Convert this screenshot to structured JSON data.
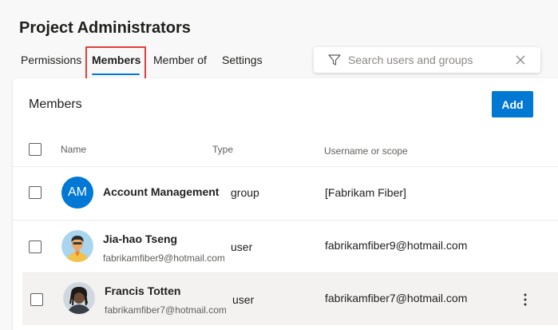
{
  "page": {
    "title": "Project Administrators"
  },
  "tabs": [
    {
      "label": "Permissions"
    },
    {
      "label": "Members"
    },
    {
      "label": "Member of"
    },
    {
      "label": "Settings"
    }
  ],
  "search": {
    "placeholder": "Search users and groups",
    "value": ""
  },
  "members_panel": {
    "title": "Members",
    "add_label": "Add",
    "columns": {
      "name": "Name",
      "type": "Type",
      "scope": "Username or scope"
    },
    "rows": [
      {
        "avatar_initials": "AM",
        "avatar_icon": "group-avatar",
        "name": "Account Management",
        "email": "",
        "type": "group",
        "scope": "[Fabrikam Fiber]"
      },
      {
        "avatar_initials": "",
        "avatar_icon": "user-avatar-illustration",
        "name": "Jia-hao Tseng",
        "email": "fabrikamfiber9@hotmail.com",
        "type": "user",
        "scope": "fabrikamfiber9@hotmail.com"
      },
      {
        "avatar_initials": "",
        "avatar_icon": "user-avatar-photo",
        "name": "Francis Totten",
        "email": "fabrikamfiber7@hotmail.com",
        "type": "user",
        "scope": "fabrikamfiber7@hotmail.com"
      }
    ]
  },
  "colors": {
    "accent": "#0078d4",
    "highlight": "#e0403a"
  }
}
